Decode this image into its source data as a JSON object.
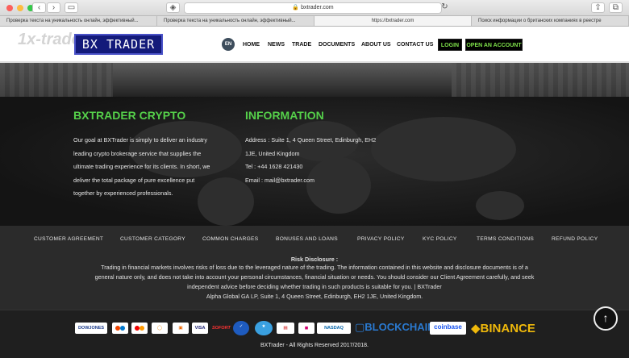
{
  "browser": {
    "url": "bxtrader.com",
    "tabs": [
      "Проверка текста на уникальность онлайн, эффективный...",
      "Проверка текста на уникальность онлайн, эффективный...",
      "https://bxtrader.com",
      "Поиск информации о британских компаниях в реестре"
    ]
  },
  "header": {
    "watermark": "1x-traders",
    "logo": "BX TRADER",
    "lang": "EN",
    "nav": [
      "HOME",
      "NEWS",
      "TRADE",
      "DOCUMENTS",
      "ABOUT US",
      "CONTACT US"
    ],
    "login": "LOGIN",
    "open_account": "OPEN AN ACCOUNT"
  },
  "about": {
    "heading": "BXTRADER CRYPTO",
    "lines": [
      "Our goal at BXTrader is simply to deliver an industry",
      "leading crypto brokerage service that supplies the",
      "ultimate trading experience for its clients. In short, we",
      "deliver the total package of pure excellence put",
      "together by experienced professionals."
    ]
  },
  "information": {
    "heading": "INFORMATION",
    "lines": [
      "Address : Suite 1, 4 Queen Street, Edinburgh, EH2",
      "1JE, United Kingdom",
      "Tel : +44 1628 421430",
      "Email : mail@bxtrader.com"
    ]
  },
  "footer_links": [
    "CUSTOMER AGREEMENT",
    "CUSTOMER CATEGORY",
    "COMMON CHARGES",
    "BONUSES AND LOANS",
    "PRIVACY POLICY",
    "KYC POLICY",
    "TERMS CONDITIONS",
    "REFUND POLICY"
  ],
  "risk": {
    "title": "Risk Disclosure :",
    "lines": [
      "Trading in financial markets involves risks of loss due to the leveraged nature of the trading. The information contained in this website and disclosure documents is of a",
      "general nature only, and does not take into account your personal circumstances, financial situation or needs. You should consider our Client Agreement carefully, and seek",
      "independent advice before deciding whether trading in such products is suitable for you. | BXTrader",
      "Alpha Global GA LP, Suite 1, 4 Queen Street, Edinburgh, EH2 1JE, United Kingdom."
    ]
  },
  "payments": {
    "small": [
      "DOWJONES",
      "",
      "",
      "",
      "",
      "VISA",
      "SOFORT",
      "",
      "",
      "",
      "",
      "NASDAQ"
    ],
    "blockchain": "BLOCKCHAIN",
    "coinbase": "coinbase",
    "binance": "BINANCE"
  },
  "copyright": "BXTrader - All Rights Reserved 2017/2018.",
  "colors": {
    "accent_green": "#55d04a",
    "logo_blue": "#131a7a",
    "button_text": "#7ee04a"
  }
}
